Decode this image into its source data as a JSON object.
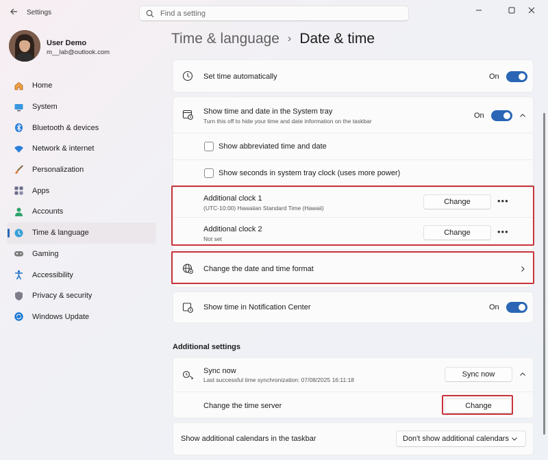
{
  "app": {
    "title": "Settings"
  },
  "search": {
    "placeholder": "Find a setting"
  },
  "profile": {
    "name": "User Demo",
    "email": "m__lab@outlook.com"
  },
  "nav": {
    "items": [
      {
        "label": "Home",
        "icon": "home-icon"
      },
      {
        "label": "System",
        "icon": "monitor-icon"
      },
      {
        "label": "Bluetooth & devices",
        "icon": "bluetooth-icon"
      },
      {
        "label": "Network & internet",
        "icon": "wifi-icon"
      },
      {
        "label": "Personalization",
        "icon": "brush-icon"
      },
      {
        "label": "Apps",
        "icon": "apps-icon"
      },
      {
        "label": "Accounts",
        "icon": "person-icon"
      },
      {
        "label": "Time & language",
        "icon": "globe-clock-icon"
      },
      {
        "label": "Gaming",
        "icon": "gamepad-icon"
      },
      {
        "label": "Accessibility",
        "icon": "accessibility-icon"
      },
      {
        "label": "Privacy & security",
        "icon": "shield-icon"
      },
      {
        "label": "Windows Update",
        "icon": "update-icon"
      }
    ],
    "active_index": 7
  },
  "breadcrumb": {
    "parent": "Time & language",
    "separator": "›",
    "current": "Date & time"
  },
  "settings": {
    "set_time_auto": {
      "title": "Set time automatically",
      "state": "On"
    },
    "tray": {
      "title": "Show time and date in the System tray",
      "subtitle": "Turn this off to hide your time and date information on the taskbar",
      "state": "On",
      "options": [
        {
          "label": "Show abbreviated time and date",
          "checked": false
        },
        {
          "label": "Show seconds in system tray clock (uses more power)",
          "checked": false
        }
      ],
      "clocks": [
        {
          "title": "Additional clock 1",
          "subtitle": "(UTC-10:00) Hawaiian Standard Time (Hawaii)",
          "button": "Change",
          "more": "•••"
        },
        {
          "title": "Additional clock 2",
          "subtitle": "Not set",
          "button": "Change",
          "more": "•••"
        }
      ]
    },
    "format": {
      "title": "Change the date and time format"
    },
    "notification_center": {
      "title": "Show time in Notification Center",
      "state": "On"
    }
  },
  "additional": {
    "heading": "Additional settings",
    "sync": {
      "title": "Sync now",
      "subtitle": "Last successful time synchronization: 07/08/2025 16:11:18",
      "button": "Sync now"
    },
    "time_server": {
      "title": "Change the time server",
      "button": "Change"
    },
    "calendars": {
      "title": "Show additional calendars in the taskbar",
      "value": "Don't show additional calendars"
    }
  },
  "colors": {
    "accent": "#2a66b5",
    "highlight_frame": "#c9323a"
  }
}
